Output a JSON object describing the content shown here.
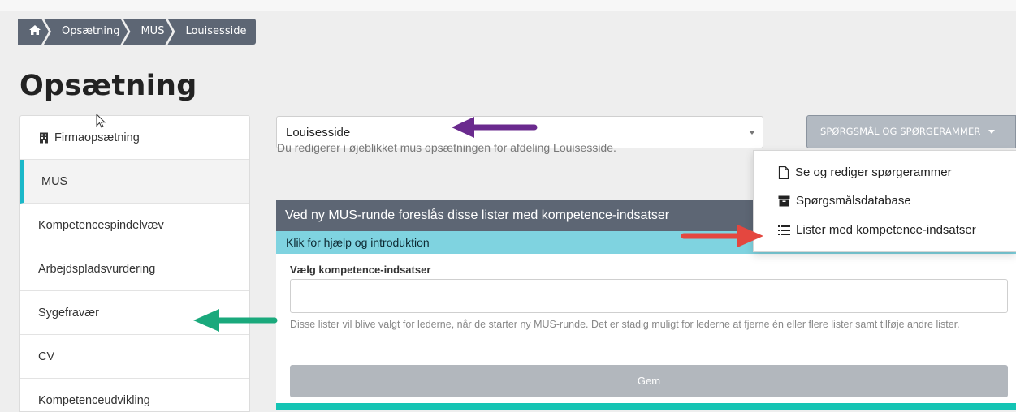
{
  "breadcrumb": {
    "items": [
      "Opsætning",
      "MUS",
      "Louisesside"
    ]
  },
  "page_title": "Opsætning",
  "sidebar": {
    "items": [
      {
        "label": "Firmaopsætning",
        "icon": "building-icon"
      },
      {
        "label": "MUS",
        "active": true
      },
      {
        "label": "Kompetencespindelvæv"
      },
      {
        "label": "Arbejdspladsvurdering"
      },
      {
        "label": "Sygefravær"
      },
      {
        "label": "CV"
      },
      {
        "label": "Kompetenceudvikling"
      }
    ]
  },
  "department_select": {
    "value": "Louisesside"
  },
  "info_text": "Du redigerer i øjeblikket mus opsætningen for afdeling Louisesside.",
  "dropdown": {
    "button_label": "SPØRGSMÅL OG SPØRGERAMMER",
    "items": [
      {
        "label": "Se og rediger spørgerammer",
        "icon": "file-icon"
      },
      {
        "label": "Spørgsmålsdatabase",
        "icon": "archive-icon"
      },
      {
        "label": "Lister med kompetence-indsatser",
        "icon": "list-icon"
      }
    ]
  },
  "panel": {
    "header": "Ved ny MUS-runde foreslås disse lister med kompetence-indsatser",
    "help_bar": "Klik for hjælp og introduktion",
    "field_label": "Vælg kompetence-indsatser",
    "field_value": "",
    "help_text": "Disse lister vil blive valgt for lederne, når de starter ny MUS-runde. Det er stadig muligt for lederne at fjerne én eller flere lister samt tilføje andre lister.",
    "save_label": "Gem"
  },
  "colors": {
    "header_bg": "#5d6674",
    "help_bar_bg": "#7fd3e0",
    "active_accent": "#1bb8c9",
    "arrow_purple": "#6a2a8e",
    "arrow_green": "#1aa97c",
    "arrow_red": "#e4473f",
    "teal_line": "#14c4b4"
  }
}
